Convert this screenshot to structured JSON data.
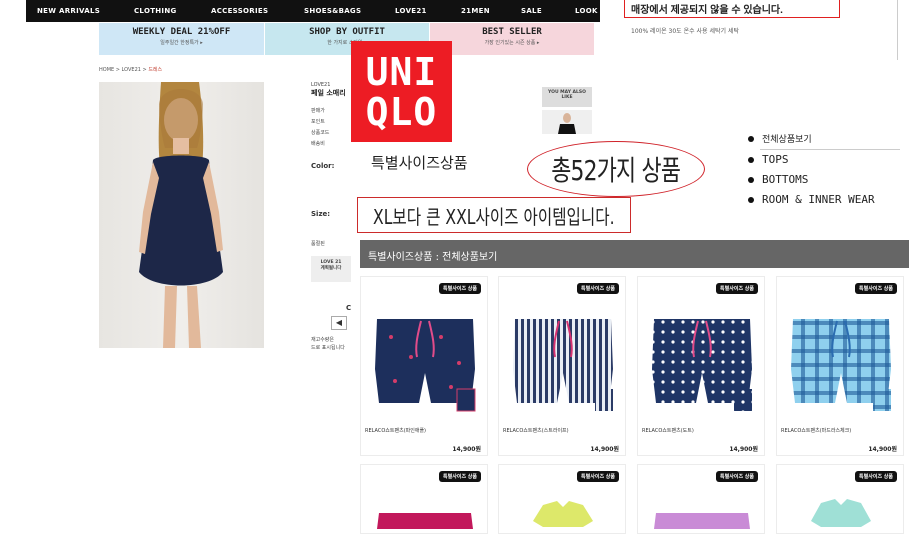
{
  "forever21": {
    "nav": [
      "NEW ARRIVALS",
      "CLOTHING",
      "ACCESSORIES",
      "SHOES&BAGS",
      "LOVE21",
      "21MEN",
      "SALE",
      "LOOK"
    ],
    "promos": [
      {
        "title": "WEEKLY DEAL 21%OFF",
        "sub": "일주일간 한정특가 ▸",
        "color": "#cfe7f6"
      },
      {
        "title": "SHOP BY OUTFIT",
        "sub": "한 가지로 스타일 ▸",
        "color": "#c6e7ef"
      },
      {
        "title": "BEST SELLER",
        "sub": "가장 인기있는 시즌 상품 ▸",
        "color": "#f6d6dc"
      }
    ],
    "breadcrumb": {
      "home": "HOME",
      "sep": " > ",
      "section": "LOVE21",
      "current": "드레스"
    },
    "product": {
      "brand": "LOVE21",
      "name": "페일 소매리",
      "rows": [
        "판매가",
        "포인트",
        "상품코드",
        "배송비"
      ],
      "color_label": "Color:",
      "size_label": "Size:",
      "stock_label": "품절된",
      "promo_box": [
        "LOVE 21",
        "계획될니다"
      ],
      "bottom_text": [
        "재고수량은",
        "드로 표시됩니다"
      ]
    },
    "you_may_also_like": "YOU MAY ALSO LIKE",
    "arrow": "◀"
  },
  "notice": {
    "text": "매장에서 제공되지 않을 수 있습니다.",
    "wash": "100% 레이온 30도 온수 사용 세탁기 세탁"
  },
  "uniqlo": {
    "logo": [
      "UNI",
      "QLO"
    ],
    "page_title": "특별사이즈상품",
    "count_text": "총52가지 상품",
    "xxl_text": "XL보다 큰 XXL사이즈 아이템입니다.",
    "categories": [
      "전체상품보기",
      "TOPS",
      "BOTTOMS",
      "ROOM & INNER WEAR"
    ],
    "bar_title": "특별사이즈상품 : 전체상품보기",
    "badge": "특별사이즈 상품",
    "products": [
      {
        "name": "RELACO쇼트팬츠(파인애플)",
        "price": "14,900원",
        "base": "#1d2f5c",
        "dot": "#d43c6a",
        "pattern": "dots"
      },
      {
        "name": "RELACO쇼트팬츠(스트라이프)",
        "price": "14,900원",
        "base": "#e9eef5",
        "dot": "#2b3b66",
        "pattern": "stripes"
      },
      {
        "name": "RELACO쇼트팬츠(도트)",
        "price": "14,900원",
        "base": "#1f3566",
        "dot": "#ffffff",
        "pattern": "dots"
      },
      {
        "name": "RELACO쇼트팬츠(마드라스체크)",
        "price": "14,900원",
        "base": "#5ab2d8",
        "dot": "#1f5c99",
        "pattern": "check"
      }
    ],
    "products_row2": [
      {
        "base": "#c2185b"
      },
      {
        "base": "#dde86a"
      },
      {
        "base": "#c98bd6"
      },
      {
        "base": "#9fe0d6"
      }
    ]
  }
}
